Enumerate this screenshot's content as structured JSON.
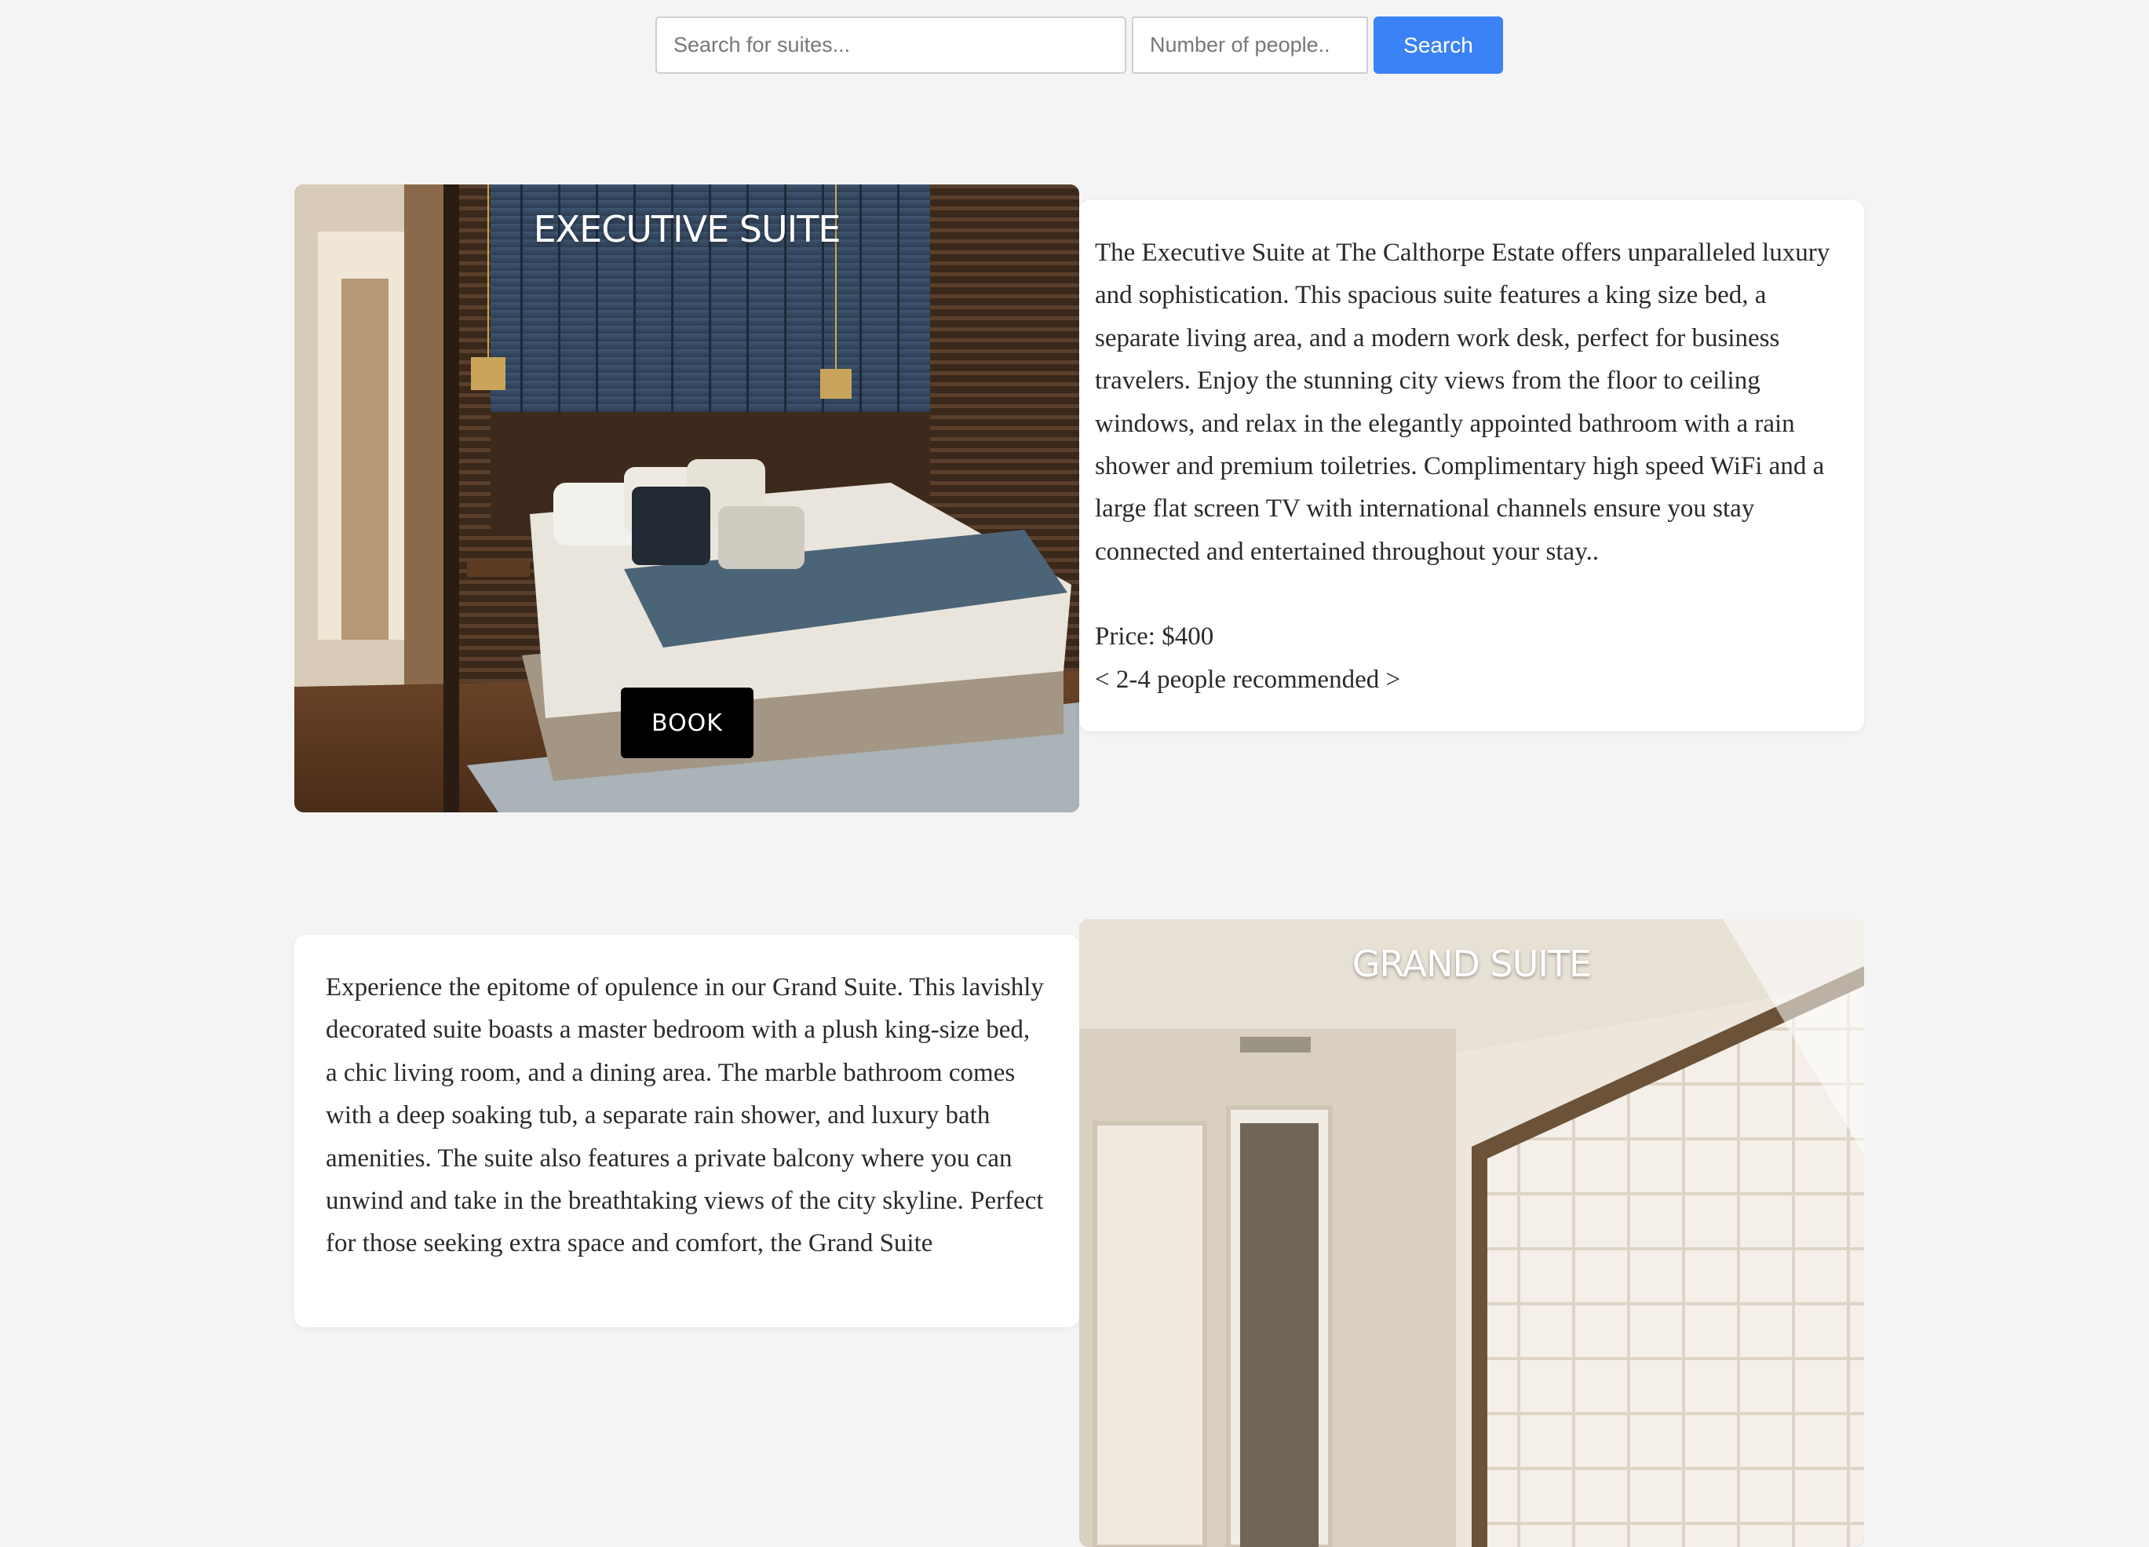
{
  "search": {
    "suite_placeholder": "Search for suites...",
    "people_placeholder": "Number of people..",
    "button_label": "Search"
  },
  "suites": [
    {
      "title": "EXECUTIVE SUITE",
      "book_label": "BOOK",
      "description": "The Executive Suite at The Calthorpe Estate offers unparalleled luxury and sophistication. This spacious suite features a king size bed, a separate living area, and a modern work desk, perfect for business travelers. Enjoy the stunning city views from the floor to ceiling windows, and relax in the elegantly appointed bathroom with a rain shower and premium toiletries. Complimentary high speed WiFi and a large flat screen TV with international channels ensure you stay connected and entertained throughout your stay..",
      "price": "Price: $400",
      "recommendation": "< 2-4 people recommended >"
    },
    {
      "title": "GRAND SUITE",
      "description": "Experience the epitome of opulence in our Grand Suite. This lavishly decorated suite boasts a master bedroom with a plush king-size bed, a chic living room, and a dining area. The marble bathroom comes with a deep soaking tub, a separate rain shower, and luxury bath amenities. The suite also features a private balcony where you can unwind and take in the breathtaking views of the city skyline. Perfect for those seeking extra space and comfort, the Grand Suite"
    }
  ],
  "colors": {
    "accent": "#3b82f6",
    "background": "#f4f4f4",
    "book_button": "#000000"
  }
}
